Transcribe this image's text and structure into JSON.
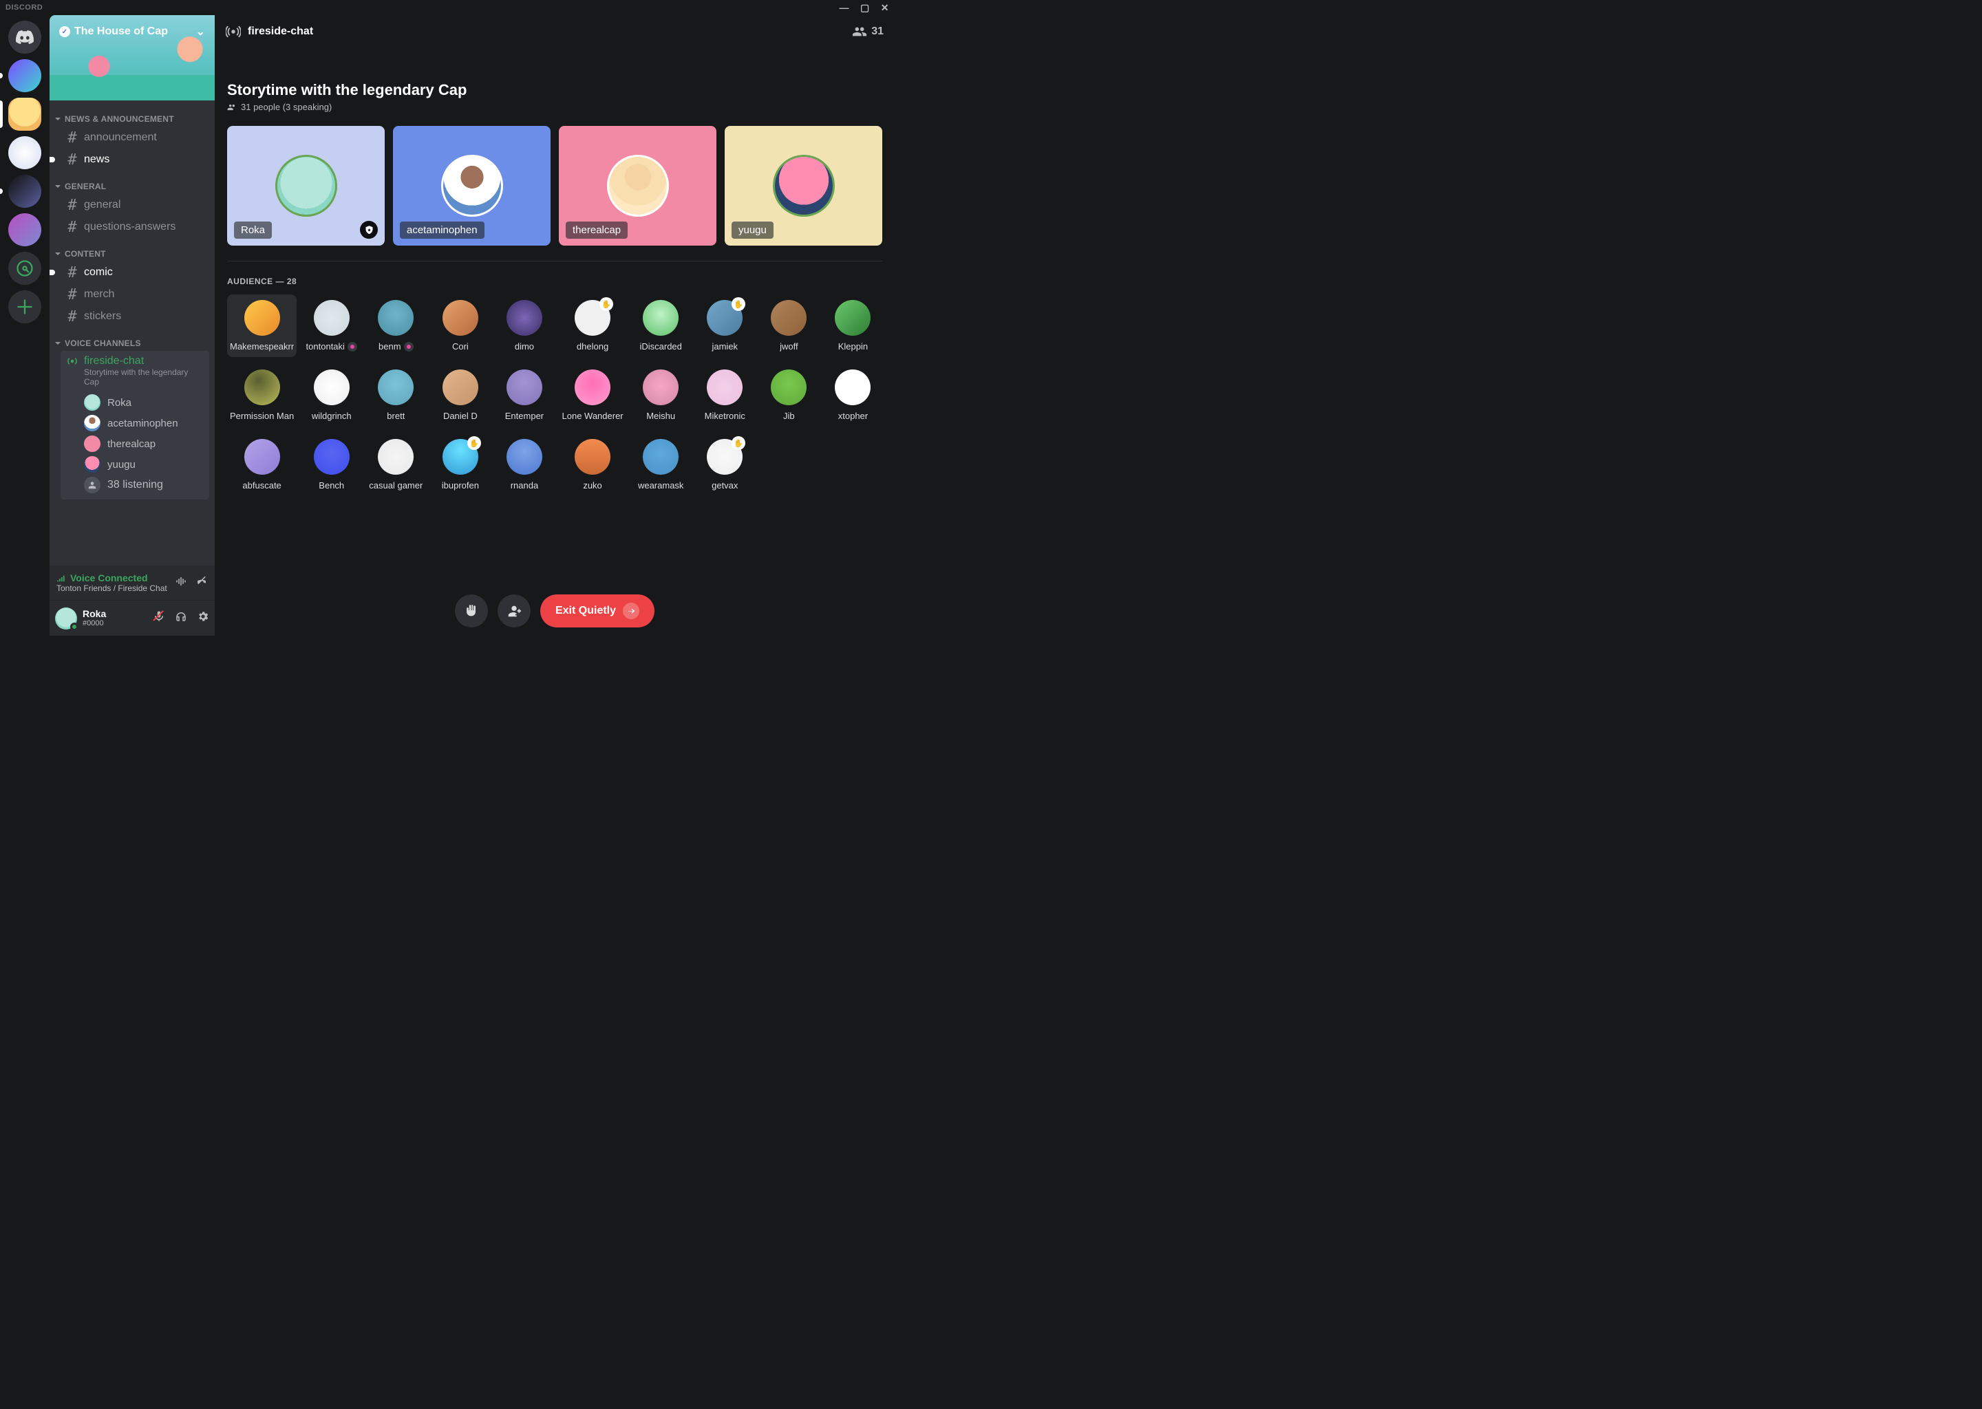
{
  "app_name": "DISCORD",
  "window": {
    "minimize": "—",
    "maximize": "▢",
    "close": "✕"
  },
  "server": {
    "name": "The House of Cap",
    "verified": true
  },
  "channel_header": {
    "icon": "stage-icon",
    "name": "fireside-chat"
  },
  "member_count": "31",
  "categories": [
    {
      "label": "NEWS & ANNOUNCEMENT",
      "channels": [
        {
          "name": "announcement",
          "type": "text",
          "unread": false
        },
        {
          "name": "news",
          "type": "text",
          "unread": true
        }
      ]
    },
    {
      "label": "GENERAL",
      "channels": [
        {
          "name": "general",
          "type": "text",
          "unread": false
        },
        {
          "name": "questions-answers",
          "type": "text",
          "unread": false
        }
      ]
    },
    {
      "label": "CONTENT",
      "channels": [
        {
          "name": "comic",
          "type": "text",
          "unread": true
        },
        {
          "name": "merch",
          "type": "text",
          "unread": false
        },
        {
          "name": "stickers",
          "type": "text",
          "unread": false
        }
      ]
    },
    {
      "label": "VOICE CHANNELS",
      "channels": [
        {
          "name": "fireside-chat",
          "type": "stage",
          "subtitle": "Storytime with the legendary Cap",
          "speakers": [
            {
              "name": "Roka"
            },
            {
              "name": "acetaminophen"
            },
            {
              "name": "therealcap"
            },
            {
              "name": "yuugu"
            }
          ],
          "listeners_label": "38 listening"
        }
      ]
    }
  ],
  "voice_panel": {
    "status": "Voice Connected",
    "subtitle": "Tonton Friends / Fireside Chat"
  },
  "user": {
    "name": "Roka",
    "tag": "#0000"
  },
  "stage": {
    "title": "Storytime with the legendary Cap",
    "subtitle": "31 people (3 speaking)",
    "speakers": [
      {
        "name": "Roka",
        "bg": "#c5cff1",
        "av": "av-frog",
        "border": "#6aa554",
        "moderator": true
      },
      {
        "name": "acetaminophen",
        "bg": "#6d8ee8",
        "av": "av-beard",
        "border": "#fff"
      },
      {
        "name": "therealcap",
        "bg": "#f28aa5",
        "av": "av-cap",
        "border": "#fff"
      },
      {
        "name": "yuugu",
        "bg": "#f1e3b2",
        "av": "av-bunny",
        "border": "#6aa554"
      }
    ],
    "audience_label": "AUDIENCE — 28",
    "audience": [
      {
        "name": "Makemespeakrr",
        "c": "c0",
        "selected": true
      },
      {
        "name": "tontontaki",
        "c": "c1",
        "badge": true
      },
      {
        "name": "benm",
        "c": "c2",
        "badge": true
      },
      {
        "name": "Cori",
        "c": "c3"
      },
      {
        "name": "dimo",
        "c": "c4"
      },
      {
        "name": "dhelong",
        "c": "c5",
        "hand": true
      },
      {
        "name": "iDiscarded",
        "c": "c6"
      },
      {
        "name": "jamiek",
        "c": "c7",
        "hand": true
      },
      {
        "name": "jwoff",
        "c": "c8"
      },
      {
        "name": "Kleppin",
        "c": "c9"
      },
      {
        "name": "Permission Man",
        "c": "c10"
      },
      {
        "name": "wildgrinch",
        "c": "c11"
      },
      {
        "name": "brett",
        "c": "c12"
      },
      {
        "name": "Daniel D",
        "c": "c13"
      },
      {
        "name": "Entemper",
        "c": "c14"
      },
      {
        "name": "Lone Wanderer",
        "c": "c15"
      },
      {
        "name": "Meishu",
        "c": "c16"
      },
      {
        "name": "Miketronic",
        "c": "c17"
      },
      {
        "name": "Jib",
        "c": "c18"
      },
      {
        "name": "xtopher",
        "c": "c19"
      },
      {
        "name": "abfuscate",
        "c": "c20"
      },
      {
        "name": "Bench",
        "c": "c21"
      },
      {
        "name": "casual gamer",
        "c": "c22"
      },
      {
        "name": "ibuprofen",
        "c": "c23",
        "hand": true
      },
      {
        "name": "rnanda",
        "c": "c24"
      },
      {
        "name": "zuko",
        "c": "c25"
      },
      {
        "name": "wearamask",
        "c": "c26"
      },
      {
        "name": "getvax",
        "c": "c27",
        "hand": true
      }
    ]
  },
  "actions": {
    "exit": "Exit Quietly"
  }
}
